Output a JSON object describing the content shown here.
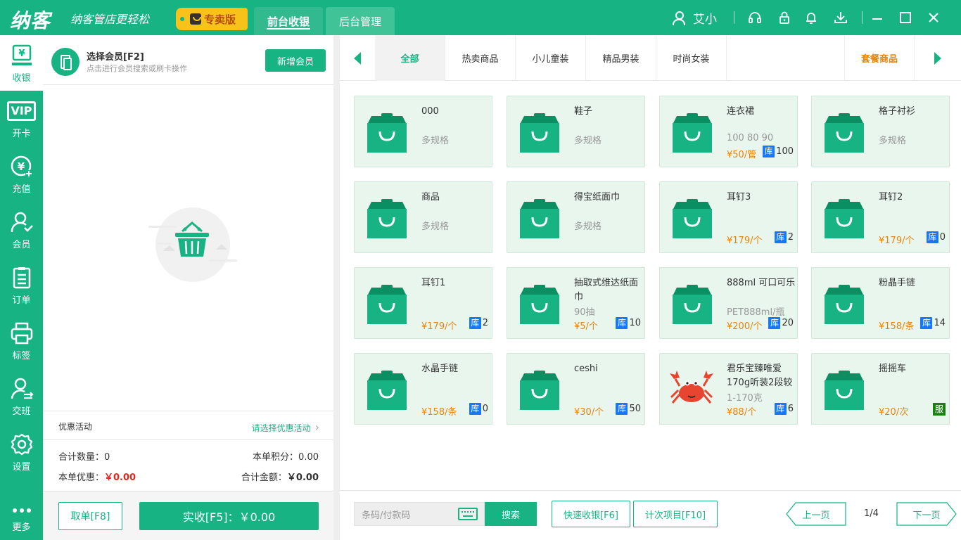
{
  "app": {
    "logo": "纳客",
    "slogan": "纳客管店更轻松",
    "edition": "专卖版",
    "tabs": [
      "前台收银",
      "后台管理"
    ],
    "user": "艾小"
  },
  "nav": [
    {
      "label": "收银",
      "icon": "cashier-icon"
    },
    {
      "label": "开卡",
      "icon": "vip-card-icon",
      "text": "VIP"
    },
    {
      "label": "充值",
      "icon": "recharge-icon"
    },
    {
      "label": "会员",
      "icon": "member-icon"
    },
    {
      "label": "订单",
      "icon": "order-icon"
    },
    {
      "label": "标签",
      "icon": "printer-icon"
    },
    {
      "label": "交班",
      "icon": "shift-icon"
    },
    {
      "label": "设置",
      "icon": "settings-icon"
    },
    {
      "label": "更多",
      "icon": "more-icon"
    }
  ],
  "member": {
    "title": "选择会员[F2]",
    "subtitle": "点击进行会员搜索或刷卡操作",
    "new_button": "新增会员"
  },
  "promo": {
    "label": "优惠活动",
    "link": "请选择优惠活动"
  },
  "summary": {
    "qty_label": "合计数量：",
    "qty": "0",
    "points_label": "本单积分：",
    "points": "0.00",
    "discount_label": "本单优惠：",
    "discount": "￥0.00",
    "total_label": "合计金额：",
    "total": "￥0.00"
  },
  "actions": {
    "cancel": "取单[F8]",
    "pay": "实收[F5]：￥0.00"
  },
  "categories": [
    "全部",
    "热卖商品",
    "小儿童装",
    "精品男装",
    "时尚女装"
  ],
  "combo_category": "套餐商品",
  "products": [
    {
      "name": "000",
      "spec": "多规格",
      "price": "",
      "stock": "",
      "tag": "",
      "icon": "shopping-bag"
    },
    {
      "name": "鞋子",
      "spec": "多规格",
      "price": "",
      "stock": "",
      "tag": "",
      "icon": "shopping-bag"
    },
    {
      "name": "连衣裙",
      "spec": "100 80 90",
      "price": "¥50/管",
      "stock": "100",
      "tag": "库",
      "icon": "shopping-bag"
    },
    {
      "name": "格子衬衫",
      "spec": "多规格",
      "price": "",
      "stock": "",
      "tag": "",
      "icon": "shopping-bag"
    },
    {
      "name": "商品",
      "spec": "多规格",
      "price": "",
      "stock": "",
      "tag": "",
      "icon": "shopping-bag"
    },
    {
      "name": "得宝纸面巾",
      "spec": "多规格",
      "price": "",
      "stock": "",
      "tag": "",
      "icon": "shopping-bag"
    },
    {
      "name": "耳钉3",
      "spec": "",
      "price": "¥179/个",
      "stock": "2",
      "tag": "库",
      "icon": "shopping-bag"
    },
    {
      "name": "耳钉2",
      "spec": "",
      "price": "¥179/个",
      "stock": "0",
      "tag": "库",
      "icon": "shopping-bag"
    },
    {
      "name": "耳钉1",
      "spec": "",
      "price": "¥179/个",
      "stock": "2",
      "tag": "库",
      "icon": "shopping-bag"
    },
    {
      "name": "抽取式维达纸面巾",
      "spec": "90抽",
      "price": "¥5/个",
      "stock": "10",
      "tag": "库",
      "icon": "shopping-bag"
    },
    {
      "name": "888ml 可口可乐",
      "spec": "PET888ml/瓶",
      "price": "¥200/个",
      "stock": "20",
      "tag": "库",
      "icon": "shopping-bag"
    },
    {
      "name": "粉晶手链",
      "spec": "",
      "price": "¥158/条",
      "stock": "14",
      "tag": "库",
      "icon": "shopping-bag"
    },
    {
      "name": "水晶手链",
      "spec": "",
      "price": "¥158/条",
      "stock": "0",
      "tag": "库",
      "icon": "shopping-bag"
    },
    {
      "name": "ceshi",
      "spec": "",
      "price": "¥30/个",
      "stock": "50",
      "tag": "库",
      "icon": "shopping-bag"
    },
    {
      "name": "君乐宝臻唯爱170g听装2段较",
      "spec": "1-170克",
      "price": "¥88/个",
      "stock": "6",
      "tag": "库",
      "icon": "crab"
    },
    {
      "name": "摇摇车",
      "spec": "",
      "price": "¥20/次",
      "stock": "",
      "tag": "服",
      "icon": "shopping-bag"
    }
  ],
  "bottom": {
    "barcode_placeholder": "条码/付款码",
    "search": "搜索",
    "quick_pay": "快速收银[F6]",
    "count_items": "计次项目[F10]",
    "prev": "上一页",
    "page": "1/4",
    "next": "下一页"
  },
  "colors": {
    "primary": "#17b383",
    "price": "#e6850e",
    "stock_badge": "#1677ff",
    "service_badge": "#18820f",
    "amount_red": "#e8251f"
  }
}
